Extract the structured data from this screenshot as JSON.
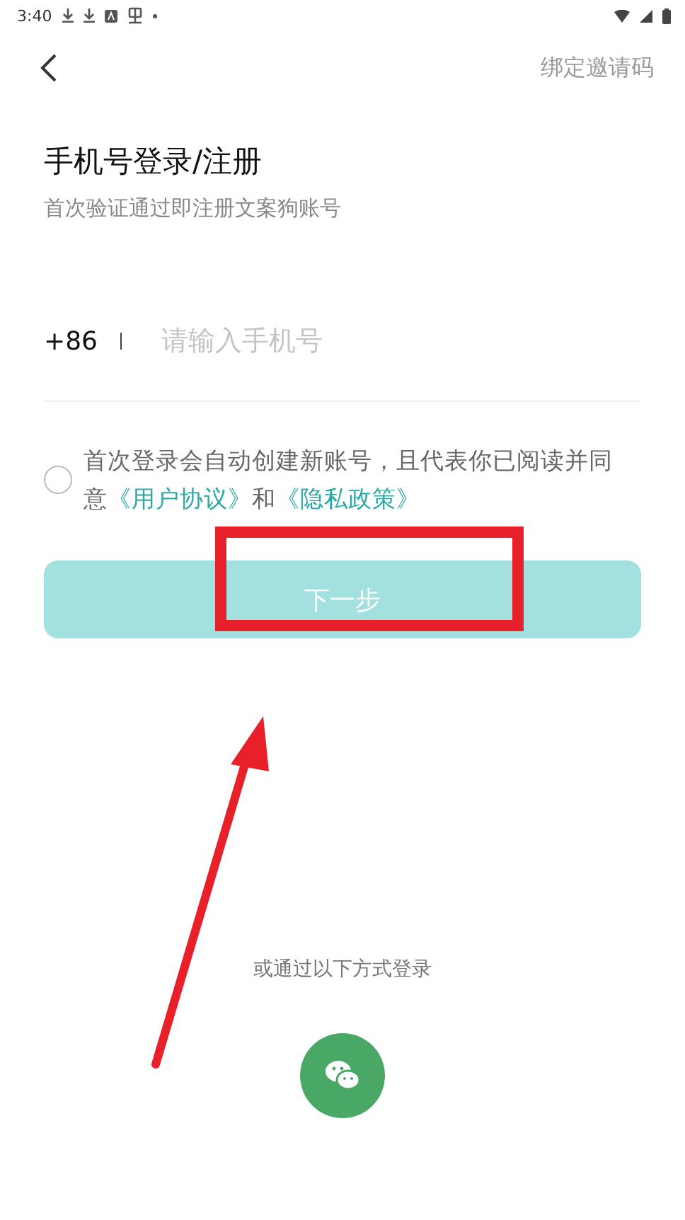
{
  "status_bar": {
    "time": "3:40"
  },
  "nav": {
    "action": "绑定邀请码"
  },
  "title": "手机号登录/注册",
  "subtitle": "首次验证通过即注册文案狗账号",
  "phone": {
    "country_code": "+86",
    "placeholder": "请输入手机号"
  },
  "agreement": {
    "checked": false,
    "text": "首次登录会自动创建新账号，且代表你已阅读并同意",
    "links": [
      "《用户协议》",
      "《隐私政策》"
    ],
    "joiner": "和"
  },
  "next_button": {
    "label": "下一步",
    "disabled": true
  },
  "alt_login": {
    "caption": "或通过以下方式登录"
  },
  "annotation": {
    "frame": true,
    "arrow": true
  }
}
